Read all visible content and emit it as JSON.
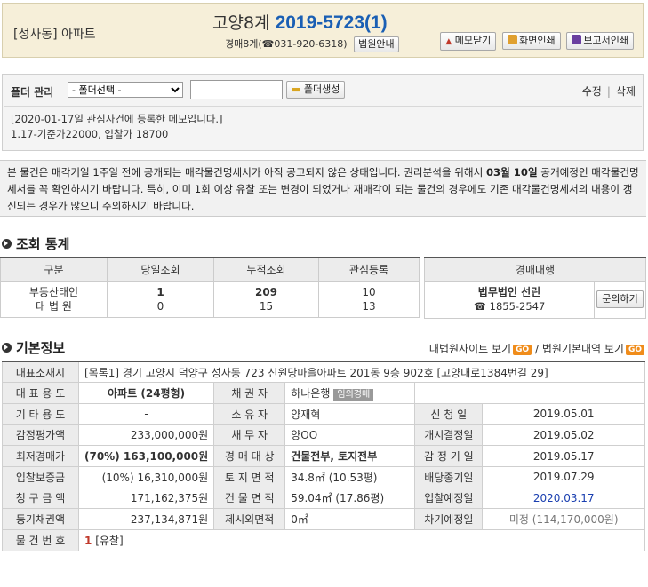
{
  "header": {
    "category": "[성사동] 아파트",
    "court_name": "고양8계",
    "case_number": "2019-5723(1)",
    "court_contact": "경매8계(☎031-920-6318)",
    "court_info_label": "법원안내",
    "btn_close_memo": "메모닫기",
    "btn_print": "화면인쇄",
    "btn_report": "보고서인쇄"
  },
  "folder": {
    "label": "폴더 관리",
    "select_value": "- 폴더선택 -",
    "create_label": "폴더생성",
    "edit_label": "수정",
    "delete_label": "삭제",
    "memo_line1": "[2020-01-17일 관심사건에 등록한 메모입니다.]",
    "memo_line2": "1.17-기준가22000, 입찰가 18700"
  },
  "notice": {
    "part1": "본 물건은 매각기일 1주일 전에 공개되는 매각물건명세서가 아직 공고되지 않은 상태입니다. 권리분석을 위해서 ",
    "date": "03월 10일",
    "part2": " 공개예정인 매각물건명세서를 꼭 확인하시기 바랍니다. 특히, 이미 1회 이상 유찰 또는 변경이 되었거나 재매각이 되는 물건의 경우에도 기존 매각물건명세서의 내용이 갱신되는 경우가 많으니 주의하시기 바랍니다."
  },
  "stats": {
    "title": "조회 통계",
    "headers": [
      "구분",
      "당일조회",
      "누적조회",
      "관심등록"
    ],
    "rows": [
      [
        "부동산태인",
        "1",
        "209",
        "10"
      ],
      [
        "대 법 원",
        "0",
        "15",
        "13"
      ]
    ],
    "agency_header": "경매대행",
    "agency_name": "법무법인 선린",
    "agency_phone": "☎ 1855-2547",
    "agency_button": "문의하기"
  },
  "basic": {
    "title": "기본정보",
    "link1": "대법원사이트 보기",
    "link2": "법원기본내역 보기",
    "go": "GO",
    "slash": "/",
    "address_label": "대표소재지",
    "address": "[목록1] 경기 고양시 덕양구 성사동 723 신원당마을아파트 201동 9층 902호 [고양대로1384번길 29]",
    "usage_label": "대 표 용 도",
    "usage": "아파트 (24평형)",
    "creditor_label": "채 권 자",
    "creditor": "하나은행",
    "creditor_tag": "임의경매",
    "other_usage_label": "기 타 용 도",
    "other_usage": "-",
    "owner_label": "소 유 자",
    "owner": "양재혁",
    "apply_label": "신 청 일",
    "apply": "2019.05.01",
    "appraisal_label": "감정평가액",
    "appraisal": "233,000,000원",
    "debtor_label": "채 무 자",
    "debtor": "양OO",
    "start_label": "개시결정일",
    "start": "2019.05.02",
    "min_label": "최저경매가",
    "min_pct": "(70%)",
    "min_price": "163,100,000원",
    "target_label": "경 매 대 상",
    "target": "건물전부, 토지전부",
    "appr_date_label": "감 정 기 일",
    "appr_date": "2019.05.17",
    "deposit_label": "입찰보증금",
    "deposit": "(10%) 16,310,000원",
    "land_label": "토 지 면 적",
    "land": "34.8㎡ (10.53평)",
    "div_label": "배당종기일",
    "div_date": "2019.07.29",
    "claim_label": "청 구 금 액",
    "claim": "171,162,375원",
    "bldg_label": "건 물 면 적",
    "bldg": "59.04㎡ (17.86평)",
    "bid_label": "입찰예정일",
    "bid_date": "2020.03.17",
    "reg_label": "등기채권액",
    "reg": "237,134,871원",
    "excl_label": "제시외면적",
    "excl": "0㎡",
    "next_label": "차기예정일",
    "next": "미정 (114,170,000원)",
    "seq_label": "물 건 번 호",
    "seq_num": "1",
    "seq_status": "[유찰]"
  },
  "colors": {
    "accent_blue": "#1a5fb4",
    "go_orange": "#f08c1a",
    "header_bg": "#f6efd9"
  }
}
